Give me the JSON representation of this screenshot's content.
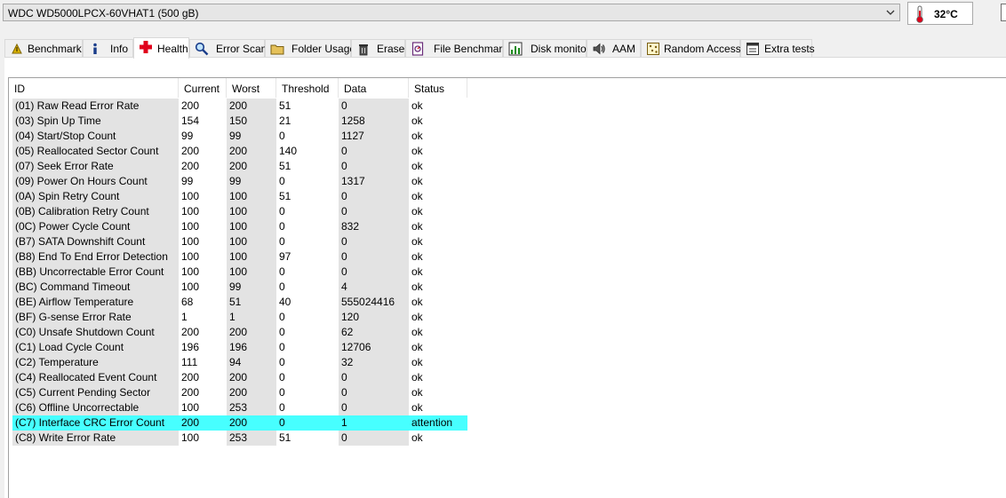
{
  "disk": {
    "selected": "WDC WD5000LPCX-60VHAT1 (500 gB)"
  },
  "temperature": {
    "value": "32°C"
  },
  "colors": {
    "attention_row": "#47ffff",
    "alt_column": "#e3e3e3",
    "health_icon": "#e0001b"
  },
  "tabs": [
    {
      "label": "Benchmark",
      "icon": "benchmark-icon"
    },
    {
      "label": "Info",
      "icon": "info-icon"
    },
    {
      "label": "Health",
      "icon": "health-cross-icon"
    },
    {
      "label": "Error Scan",
      "icon": "magnifier-icon"
    },
    {
      "label": "Folder Usage",
      "icon": "folder-icon"
    },
    {
      "label": "Erase",
      "icon": "trash-icon"
    },
    {
      "label": "File Benchmark",
      "icon": "file-benchmark-icon"
    },
    {
      "label": "Disk monitor",
      "icon": "monitor-chart-icon"
    },
    {
      "label": "AAM",
      "icon": "speaker-icon"
    },
    {
      "label": "Random Access",
      "icon": "random-access-icon"
    },
    {
      "label": "Extra tests",
      "icon": "extra-tests-icon"
    }
  ],
  "active_tab": "Health",
  "table": {
    "columns": [
      "ID",
      "Current",
      "Worst",
      "Threshold",
      "Data",
      "Status"
    ],
    "rows": [
      [
        "(01) Raw Read Error Rate",
        "200",
        "200",
        "51",
        "0",
        "ok"
      ],
      [
        "(03) Spin Up Time",
        "154",
        "150",
        "21",
        "1258",
        "ok"
      ],
      [
        "(04) Start/Stop Count",
        "99",
        "99",
        "0",
        "1127",
        "ok"
      ],
      [
        "(05) Reallocated Sector Count",
        "200",
        "200",
        "140",
        "0",
        "ok"
      ],
      [
        "(07) Seek Error Rate",
        "200",
        "200",
        "51",
        "0",
        "ok"
      ],
      [
        "(09) Power On Hours Count",
        "99",
        "99",
        "0",
        "1317",
        "ok"
      ],
      [
        "(0A) Spin Retry Count",
        "100",
        "100",
        "51",
        "0",
        "ok"
      ],
      [
        "(0B) Calibration Retry Count",
        "100",
        "100",
        "0",
        "0",
        "ok"
      ],
      [
        "(0C) Power Cycle Count",
        "100",
        "100",
        "0",
        "832",
        "ok"
      ],
      [
        "(B7) SATA Downshift Count",
        "100",
        "100",
        "0",
        "0",
        "ok"
      ],
      [
        "(B8) End To End Error Detection",
        "100",
        "100",
        "97",
        "0",
        "ok"
      ],
      [
        "(BB) Uncorrectable Error Count",
        "100",
        "100",
        "0",
        "0",
        "ok"
      ],
      [
        "(BC) Command Timeout",
        "100",
        "99",
        "0",
        "4",
        "ok"
      ],
      [
        "(BE) Airflow Temperature",
        "68",
        "51",
        "40",
        "555024416",
        "ok"
      ],
      [
        "(BF) G-sense Error Rate",
        "1",
        "1",
        "0",
        "120",
        "ok"
      ],
      [
        "(C0) Unsafe Shutdown Count",
        "200",
        "200",
        "0",
        "62",
        "ok"
      ],
      [
        "(C1) Load Cycle Count",
        "196",
        "196",
        "0",
        "12706",
        "ok"
      ],
      [
        "(C2) Temperature",
        "111",
        "94",
        "0",
        "32",
        "ok"
      ],
      [
        "(C4) Reallocated Event Count",
        "200",
        "200",
        "0",
        "0",
        "ok"
      ],
      [
        "(C5) Current Pending Sector",
        "200",
        "200",
        "0",
        "0",
        "ok"
      ],
      [
        "(C6) Offline Uncorrectable",
        "100",
        "253",
        "0",
        "0",
        "ok"
      ],
      [
        "(C7) Interface CRC Error Count",
        "200",
        "200",
        "0",
        "1",
        "attention"
      ],
      [
        "(C8) Write Error Rate",
        "100",
        "253",
        "51",
        "0",
        "ok"
      ]
    ]
  }
}
